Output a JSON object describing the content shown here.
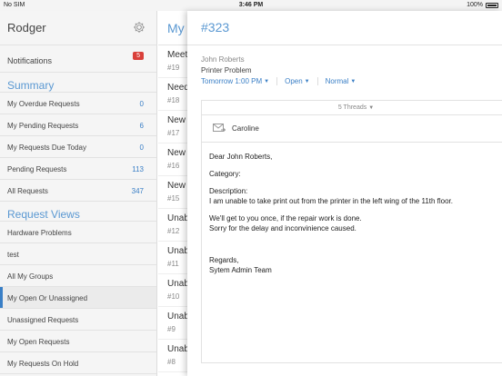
{
  "statusbar": {
    "carrier": "No SIM",
    "time": "3:46 PM",
    "battery": "100%"
  },
  "sidebar": {
    "user": "Rodger",
    "notifications": {
      "label": "Notifications",
      "count": "5"
    },
    "summary_title": "Summary",
    "summary": [
      {
        "label": "My Overdue Requests",
        "count": "0"
      },
      {
        "label": "My Pending Requests",
        "count": "6"
      },
      {
        "label": "My Requests Due Today",
        "count": "0"
      },
      {
        "label": "Pending Requests",
        "count": "113"
      },
      {
        "label": "All Requests",
        "count": "347"
      }
    ],
    "views_title": "Request Views",
    "views": [
      {
        "label": "Hardware Problems"
      },
      {
        "label": "test"
      },
      {
        "label": "All My Groups"
      },
      {
        "label": "My Open Or Unassigned"
      },
      {
        "label": "Unassigned Requests"
      },
      {
        "label": "My Open Requests"
      },
      {
        "label": "My Requests On Hold"
      }
    ]
  },
  "list": {
    "title": "My",
    "items": [
      {
        "title": "Meet",
        "num": "#19"
      },
      {
        "title": "Need",
        "num": "#18"
      },
      {
        "title": "New",
        "num": "#17"
      },
      {
        "title": "New",
        "num": "#16"
      },
      {
        "title": "New",
        "num": "#15"
      },
      {
        "title": "Unab",
        "num": "#12"
      },
      {
        "title": "Unab",
        "num": "#11"
      },
      {
        "title": "Unab",
        "num": "#10"
      },
      {
        "title": "Unab",
        "num": "#9"
      },
      {
        "title": "Unab",
        "num": "#8"
      }
    ]
  },
  "detail": {
    "id": "#323",
    "requester": "John Roberts",
    "subject": "Printer Problem",
    "due": "Tomorrow 1:00 PM",
    "status": "Open",
    "priority": "Normal",
    "threads": "5 Threads",
    "from": "Caroline",
    "body": {
      "greeting": "Dear John Roberts,",
      "category": "Category:",
      "desc_label": "Description:",
      "desc": "I am unable to take print out from the printer in the left wing of the 11th floor.",
      "line1": "We'll get to you once, if the repair work is done.",
      "line2": "Sorry for the delay and inconvinience caused.",
      "regards": "Regards,",
      "signature": "Sytem Admin Team"
    }
  },
  "colors": {
    "accent": "#3a7fc6",
    "badge": "#d9403a"
  }
}
